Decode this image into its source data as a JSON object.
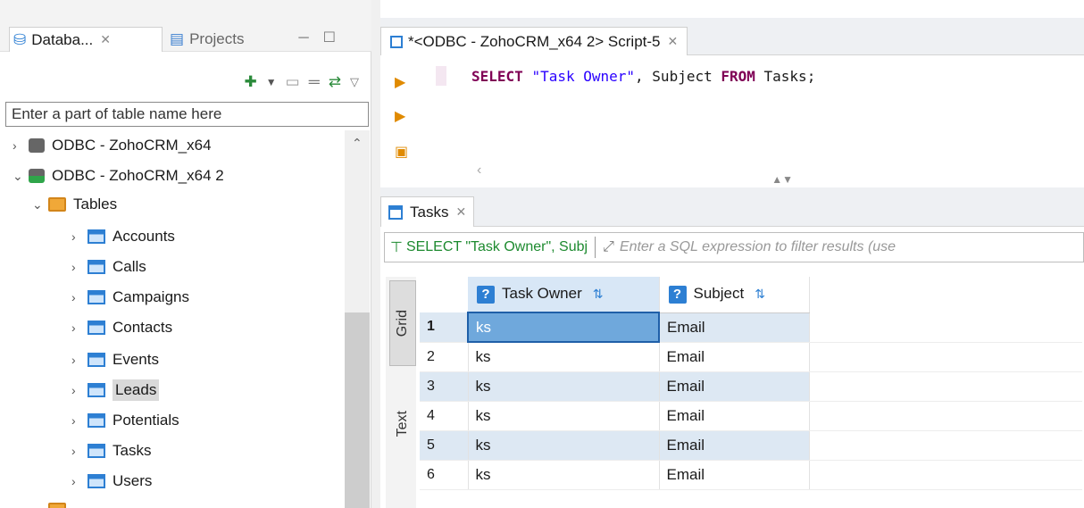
{
  "left_panel": {
    "tab_active": "Databa...",
    "tab_inactive": "Projects",
    "filter_placeholder": "Enter a part of table name here",
    "connections": [
      "ODBC - ZohoCRM_x64",
      "ODBC - ZohoCRM_x64 2"
    ],
    "folder": "Tables",
    "tables": [
      "Accounts",
      "Calls",
      "Campaigns",
      "Contacts",
      "Events",
      "Leads",
      "Potentials",
      "Tasks",
      "Users"
    ],
    "selected_table": "Leads"
  },
  "editor": {
    "tab_title": "*<ODBC - ZohoCRM_x64 2> Script-5",
    "sql": {
      "kw1": "SELECT",
      "str": "\"Task Owner\"",
      "mid": ", Subject ",
      "kw2": "FROM",
      "tail": " Tasks;"
    }
  },
  "results": {
    "tab_title": "Tasks",
    "filter_sql": "SELECT \"Task Owner\", Subj",
    "filter_hint": "Enter a SQL expression to filter results (use",
    "side_grid": "Grid",
    "side_text": "Text",
    "columns": [
      "Task Owner",
      "Subject"
    ],
    "rows": [
      {
        "n": "1",
        "owner": "ks",
        "subject": "Email"
      },
      {
        "n": "2",
        "owner": "ks",
        "subject": "Email"
      },
      {
        "n": "3",
        "owner": "ks",
        "subject": "Email"
      },
      {
        "n": "4",
        "owner": "ks",
        "subject": "Email"
      },
      {
        "n": "5",
        "owner": "ks",
        "subject": "Email"
      },
      {
        "n": "6",
        "owner": "ks",
        "subject": "Email"
      }
    ]
  },
  "colors": {
    "accent": "#2d7fd3",
    "selected_cell": "#6fa8dc",
    "alt_row": "#dde8f3",
    "keyword": "#7f0055",
    "string": "#2a00ff"
  }
}
